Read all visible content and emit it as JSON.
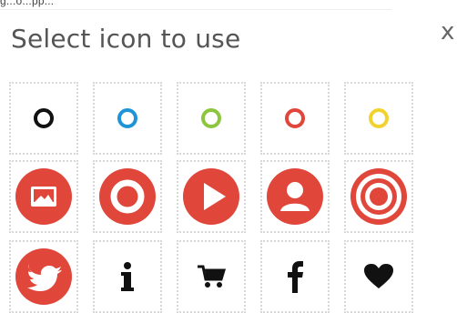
{
  "page": {
    "partial_text": "g...o...pp...",
    "title": "Select icon to use",
    "close_label": "x"
  },
  "icons": [
    {
      "name": "circle-outline-black-icon",
      "color": "#111111"
    },
    {
      "name": "circle-outline-blue-icon",
      "color": "#1f95d8"
    },
    {
      "name": "circle-outline-green-icon",
      "color": "#8cc63f"
    },
    {
      "name": "circle-outline-red-icon",
      "color": "#e0473a"
    },
    {
      "name": "circle-outline-yellow-icon",
      "color": "#f2d22e"
    },
    {
      "name": "image-icon",
      "color": "#e0473a"
    },
    {
      "name": "record-icon",
      "color": "#e0473a"
    },
    {
      "name": "play-icon",
      "color": "#e0473a"
    },
    {
      "name": "user-icon",
      "color": "#e0473a"
    },
    {
      "name": "target-icon",
      "color": "#e0473a"
    },
    {
      "name": "twitter-bird-icon",
      "color": "#e0473a"
    },
    {
      "name": "info-icon",
      "color": "#111111"
    },
    {
      "name": "shopping-cart-icon",
      "color": "#111111"
    },
    {
      "name": "facebook-icon",
      "color": "#111111"
    },
    {
      "name": "heart-icon",
      "color": "#111111"
    }
  ],
  "accent": "#e0473a"
}
